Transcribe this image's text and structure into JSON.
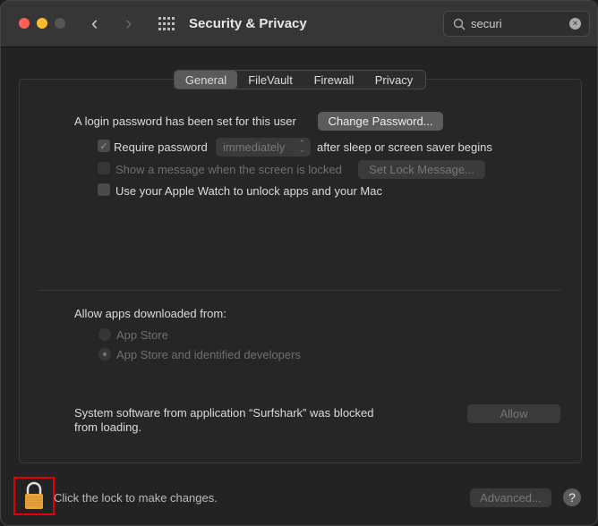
{
  "window": {
    "title": "Security & Privacy",
    "search_value": "securi"
  },
  "tabs": [
    {
      "label": "General",
      "active": true
    },
    {
      "label": "FileVault"
    },
    {
      "label": "Firewall"
    },
    {
      "label": "Privacy"
    }
  ],
  "general": {
    "login_text": "A login password has been set for this user",
    "change_password": "Change Password...",
    "require_password": {
      "label": "Require password",
      "checked": true,
      "select_value": "immediately",
      "suffix": "after sleep or screen saver begins"
    },
    "show_message": {
      "label": "Show a message when the screen is locked",
      "checked": false,
      "button": "Set Lock Message..."
    },
    "apple_watch": {
      "label": "Use your Apple Watch to unlock apps and your Mac",
      "checked": false
    },
    "allow_apps_label": "Allow apps downloaded from:",
    "radio_options": [
      {
        "label": "App Store",
        "selected": false
      },
      {
        "label": "App Store and identified developers",
        "selected": true
      }
    ],
    "blocked_text_1": "System software from application “Surfshark” was blocked",
    "blocked_text_2": "from loading.",
    "allow_button": "Allow"
  },
  "footer": {
    "lock_text": "Click the lock to make changes.",
    "advanced": "Advanced...",
    "help": "?"
  },
  "colors": {
    "close": "#fe5f57",
    "minimize": "#febc2e",
    "highlight": "#e00000",
    "lock": "#e8a43c"
  }
}
